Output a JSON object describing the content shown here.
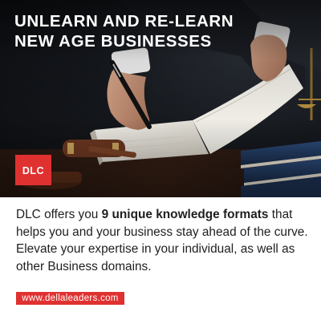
{
  "headline": {
    "line1": "UNLEARN AND RE-LEARN",
    "line2": "NEW AGE BUSINESSES"
  },
  "logo": {
    "text": "DLC",
    "color": "#e03131"
  },
  "body": {
    "part1": "DLC offers you ",
    "highlight": "9 unique knowledge formats",
    "part2": " that helps you and your business stay ahead of the curve. Elevate your expertise in your individual, as well as other Business domains."
  },
  "website": {
    "label": "www.dellaleaders.com",
    "background": "#e03131"
  },
  "icons": [
    "pen-icon",
    "gavel-icon",
    "scales-icon"
  ]
}
